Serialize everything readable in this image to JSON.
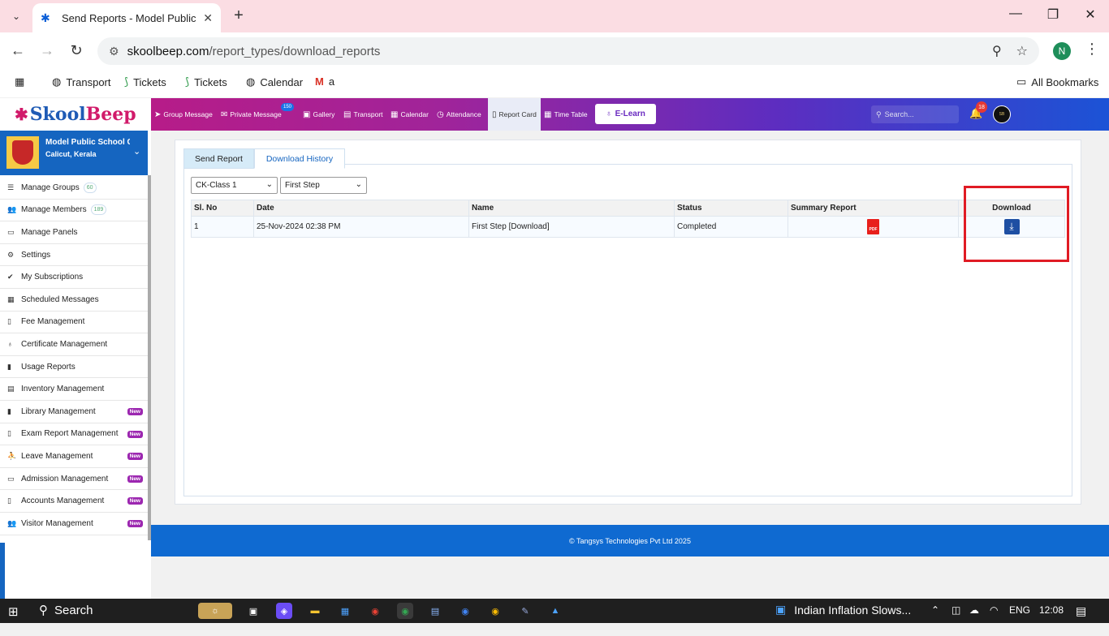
{
  "browser": {
    "tab_title": "Send Reports - Model Public Sc",
    "url_host": "skoolbeep.com",
    "url_path": "/report_types/download_reports",
    "profile_initial": "N",
    "bookmarks": [
      "Transport",
      "Tickets",
      "Tickets",
      "Calendar",
      "a"
    ],
    "all_bookmarks": "All Bookmarks"
  },
  "app": {
    "logo_skool": "Skool",
    "logo_beep": "Beep",
    "nav": [
      "Group Message",
      "Private Message",
      "Gallery",
      "Transport",
      "Calendar",
      "Attendance",
      "Report Card",
      "Time Table"
    ],
    "private_msg_badge": "150",
    "elearn": "E-Learn",
    "search_placeholder": "Search...",
    "notifications": "18"
  },
  "sidebar": {
    "school_name": "Model Public School C",
    "school_location": "Calicut, Kerala",
    "items": [
      {
        "label": "Manage Groups",
        "count": "60"
      },
      {
        "label": "Manage Members",
        "count": "189"
      },
      {
        "label": "Manage Panels"
      },
      {
        "label": "Settings"
      },
      {
        "label": "My Subscriptions"
      },
      {
        "label": "Scheduled Messages"
      },
      {
        "label": "Fee Management"
      },
      {
        "label": "Certificate Management"
      },
      {
        "label": "Usage Reports"
      },
      {
        "label": "Inventory Management"
      },
      {
        "label": "Library Management",
        "badge": "New"
      },
      {
        "label": "Exam Report Management",
        "badge": "New"
      },
      {
        "label": "Leave Management",
        "badge": "New"
      },
      {
        "label": "Admission Management",
        "badge": "New"
      },
      {
        "label": "Accounts Management",
        "badge": "New"
      },
      {
        "label": "Visitor Management",
        "badge": "New"
      }
    ]
  },
  "main": {
    "tabs": [
      "Send Report",
      "Download History"
    ],
    "class_select": "CK-Class 1",
    "step_select": "First Step",
    "table": {
      "headers": [
        "Sl. No",
        "Date",
        "Name",
        "Status",
        "Summary Report",
        "Download"
      ],
      "rows": [
        {
          "slno": "1",
          "date": "25-Nov-2024 02:38 PM",
          "name": "First Step [Download]",
          "status": "Completed"
        }
      ]
    },
    "pdf_label": "PDF"
  },
  "footer": "© Tangsys Technologies Pvt Ltd 2025",
  "taskbar": {
    "search": "Search",
    "news": "Indian Inflation Slows...",
    "lang": "ENG",
    "time": "12:08"
  }
}
